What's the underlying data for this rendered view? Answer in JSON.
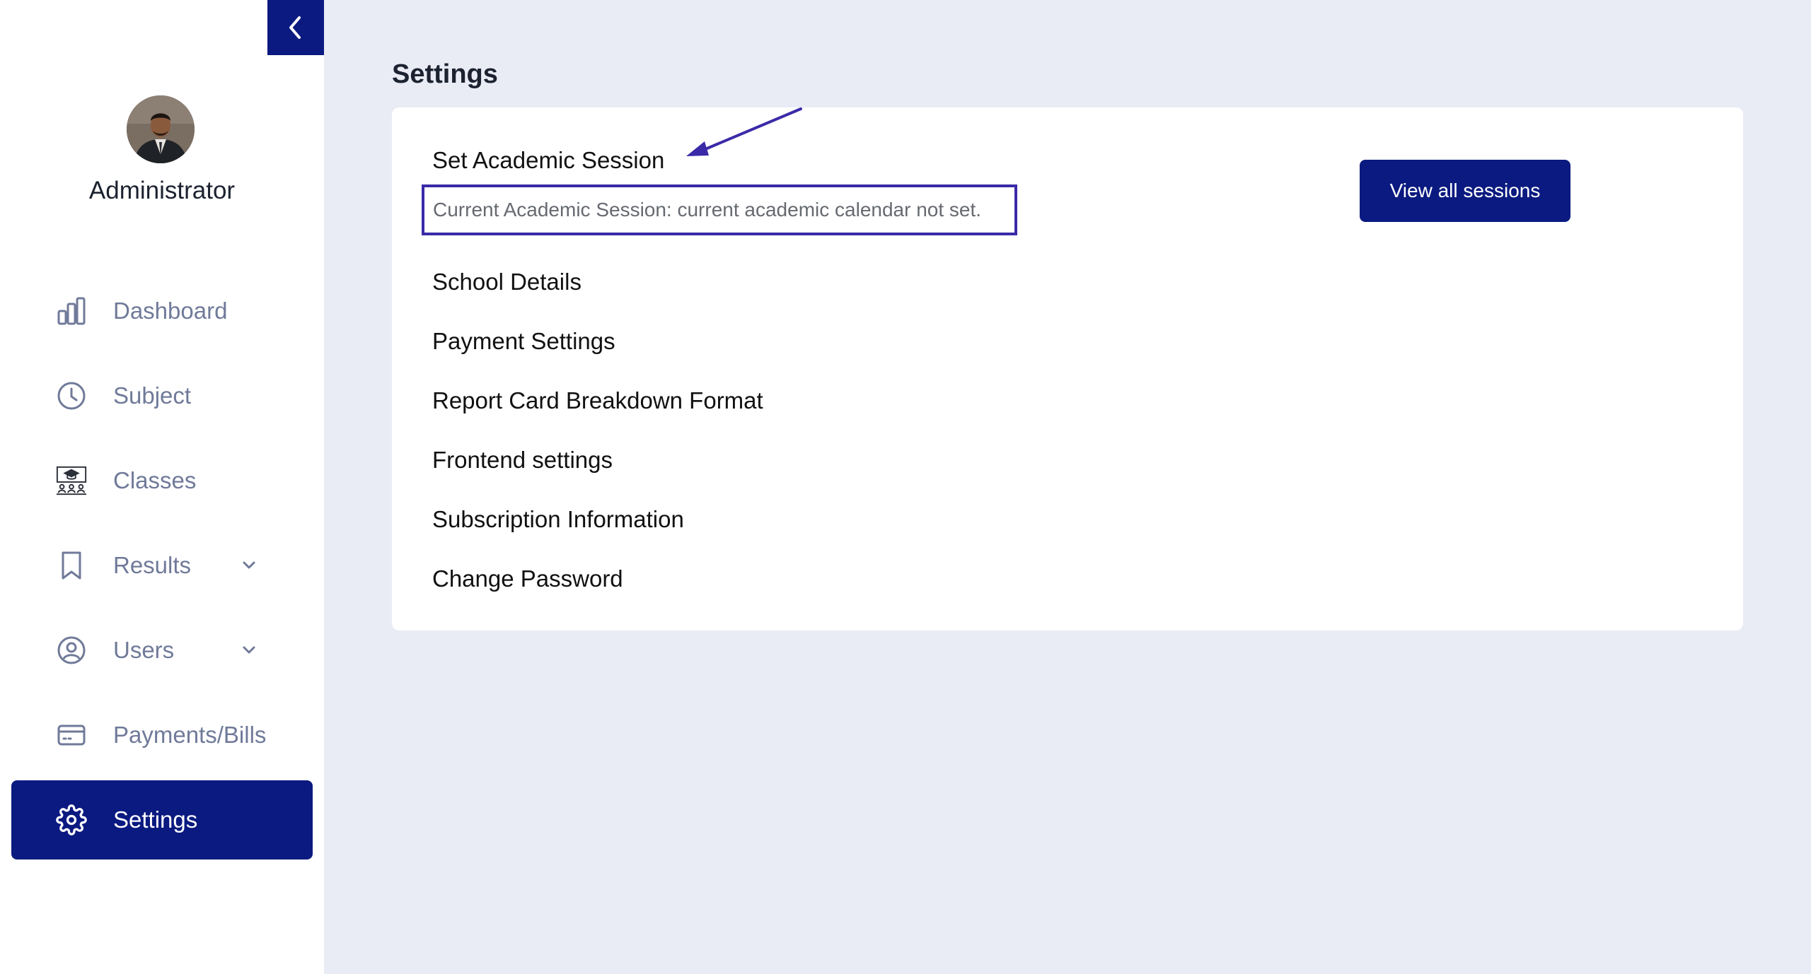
{
  "sidebar": {
    "profile_name": "Administrator",
    "items": [
      {
        "label": "Dashboard",
        "icon": "bar-chart-icon",
        "active": false,
        "has_chevron": false
      },
      {
        "label": "Subject",
        "icon": "clock-icon",
        "active": false,
        "has_chevron": false
      },
      {
        "label": "Classes",
        "icon": "classroom-icon",
        "active": false,
        "has_chevron": false
      },
      {
        "label": "Results",
        "icon": "bookmark-icon",
        "active": false,
        "has_chevron": true
      },
      {
        "label": "Users",
        "icon": "user-circle-icon",
        "active": false,
        "has_chevron": true
      },
      {
        "label": "Payments/Bills",
        "icon": "credit-card-icon",
        "active": false,
        "has_chevron": false
      },
      {
        "label": "Settings",
        "icon": "gear-icon",
        "active": true,
        "has_chevron": false
      }
    ]
  },
  "main": {
    "title": "Settings",
    "academic_session": {
      "heading": "Set Academic Session",
      "current": "Current Academic Session: current academic calendar not set.",
      "button_label": "View all sessions"
    },
    "links": [
      "School Details",
      "Payment Settings",
      "Report Card Breakdown Format",
      "Frontend settings",
      "Subscription Information",
      "Change Password"
    ]
  },
  "colors": {
    "primary": "#0b1a80",
    "annotation": "#3b2aa8",
    "page_background": "#e9ecf4",
    "nav_text": "#707a99"
  }
}
